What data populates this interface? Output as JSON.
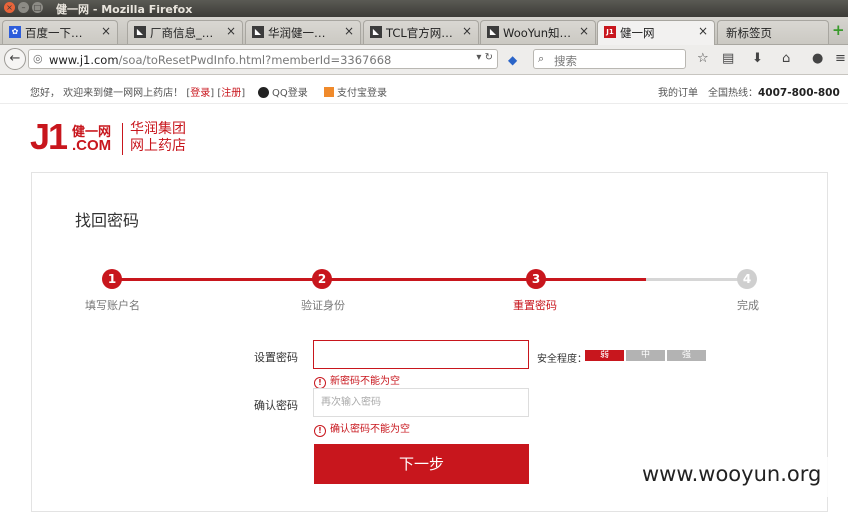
{
  "window": {
    "title": "健一网 - Mozilla Firefox"
  },
  "tabs": [
    {
      "label": "百度一下…",
      "icon": "baidu-paw-icon"
    },
    {
      "label": "厂商信息_…",
      "icon": "wooyun-icon"
    },
    {
      "label": "华润健一…",
      "icon": "wooyun-icon"
    },
    {
      "label": "TCL官方网…",
      "icon": "wooyun-icon"
    },
    {
      "label": "WooYun知…",
      "icon": "wooyun-icon"
    },
    {
      "label": "健一网",
      "icon": "j1-icon",
      "active": true
    },
    {
      "label": "新标签页",
      "icon": ""
    }
  ],
  "nav": {
    "url_host": "www.j1.com",
    "url_path": "/soa/toResetPwdInfo.html?memberId=3367668",
    "search_placeholder": "搜索"
  },
  "sitetop": {
    "welcome": "您好， 欢迎来到健一网网上药店！ [",
    "login": "登录",
    "mid": "] [",
    "register": "注册",
    "end": "]",
    "qq_login": "QQ登录",
    "alipay_login": "支付宝登录",
    "my_orders": "我的订单",
    "hotline_label": "全国热线：",
    "hotline_number": "4007-800-800"
  },
  "logo": {
    "j1": "J1",
    "brand": "健一网",
    "com": ".COM",
    "group_line1": "华润集团",
    "group_line2": "网上药店"
  },
  "page": {
    "title": "找回密码"
  },
  "steps": [
    {
      "num": "1",
      "label": "填写账户名",
      "state": "done"
    },
    {
      "num": "2",
      "label": "验证身份",
      "state": "done"
    },
    {
      "num": "3",
      "label": "重置密码",
      "state": "current"
    },
    {
      "num": "4",
      "label": "完成",
      "state": "todo"
    }
  ],
  "form": {
    "password_label": "设置密码",
    "password_value": "",
    "password_error": "新密码不能为空",
    "confirm_label": "确认密码",
    "confirm_placeholder": "再次输入密码",
    "confirm_error": "确认密码不能为空",
    "strength_label": "安全程度：",
    "strength_levels": [
      "弱",
      "中",
      "强"
    ],
    "submit_label": "下一步"
  },
  "colors": {
    "brand_red": "#c8161d",
    "step_inactive": "#cfcfcf"
  },
  "watermark": "www.wooyun.org"
}
